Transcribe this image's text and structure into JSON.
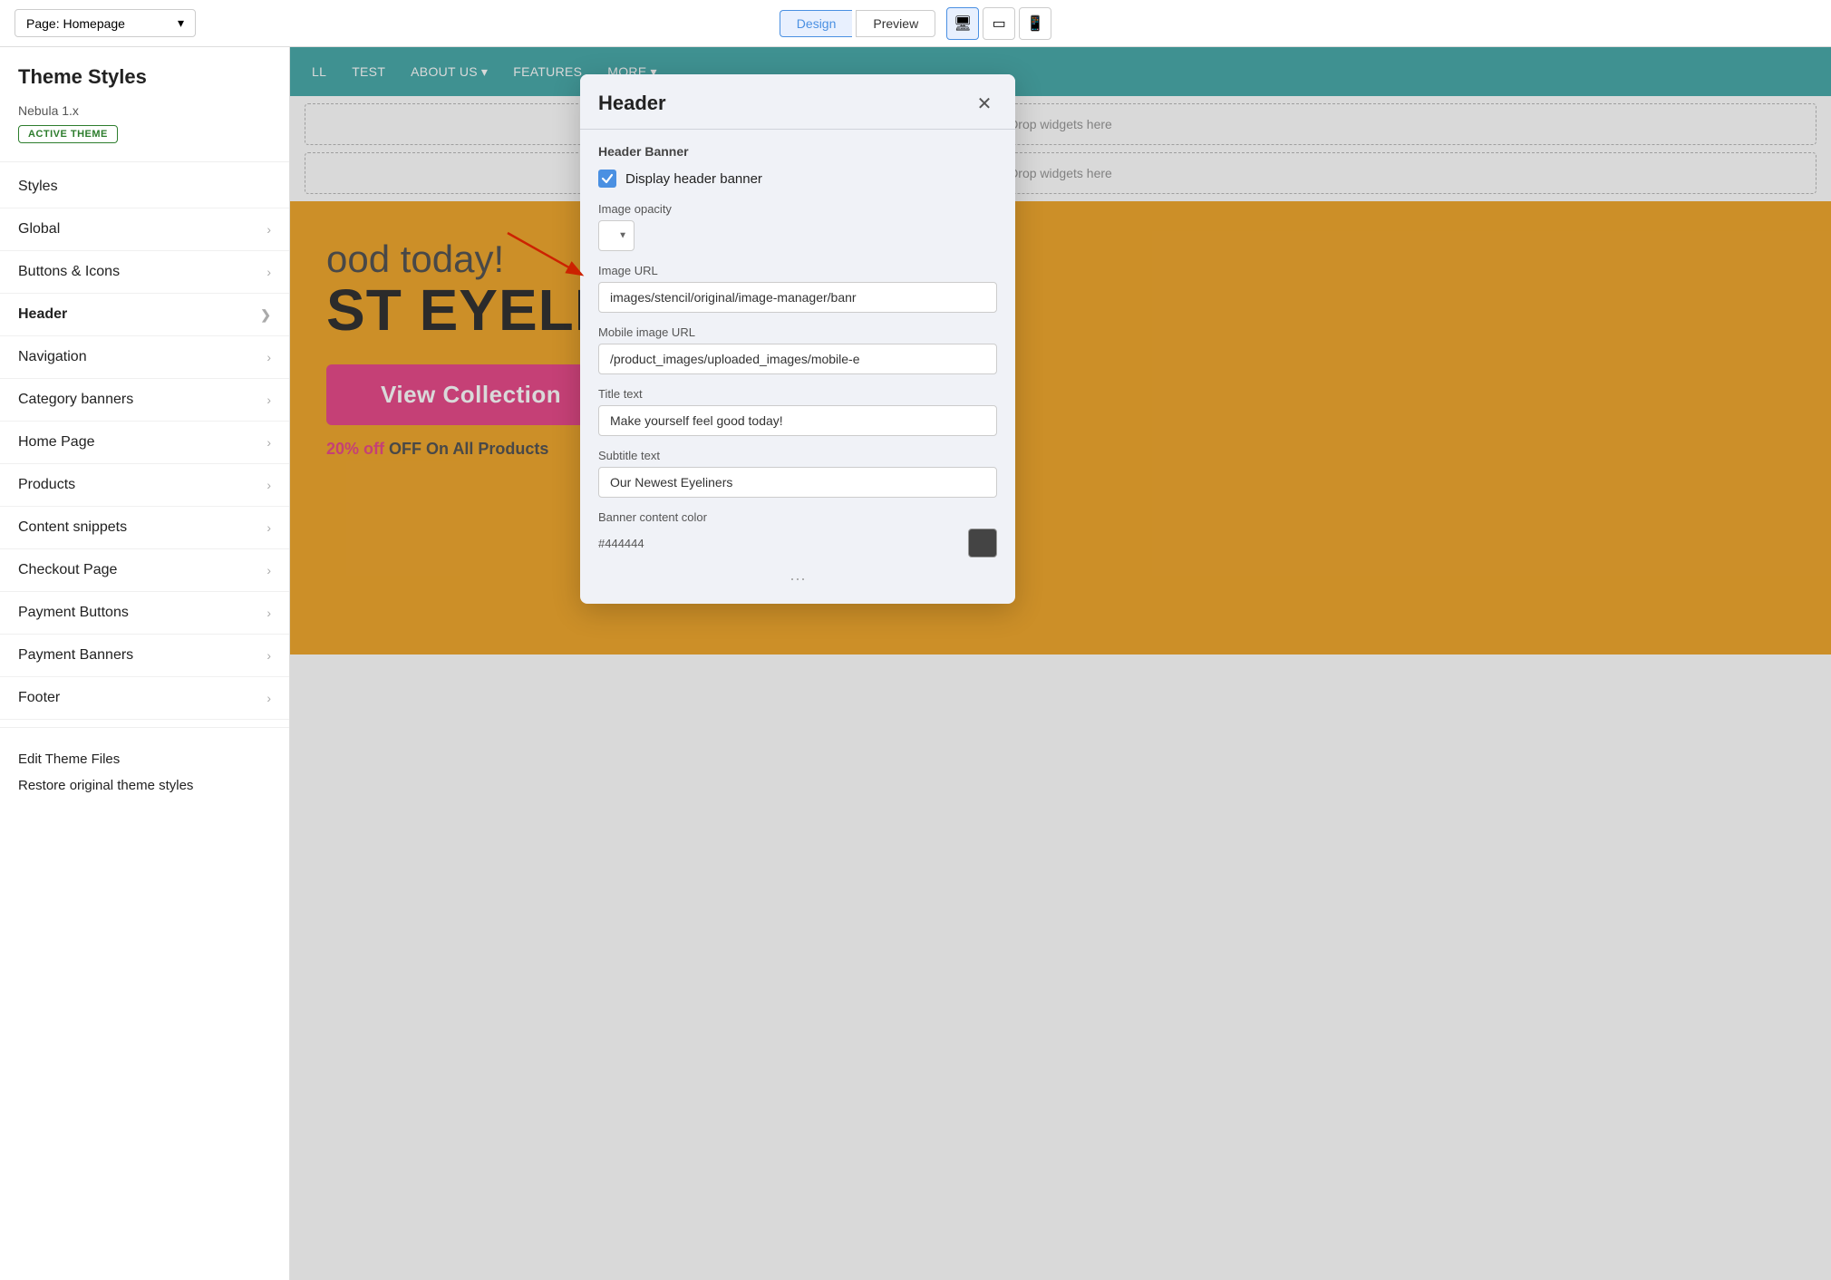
{
  "topbar": {
    "page_selector": "Page: Homepage",
    "btn_design": "Design",
    "btn_preview": "Preview",
    "devices": [
      "desktop",
      "tablet",
      "mobile"
    ]
  },
  "sidebar": {
    "title": "Theme Styles",
    "theme_name": "Nebula 1.x",
    "active_badge": "ACTIVE THEME",
    "items": [
      {
        "label": "Styles",
        "has_chevron": false
      },
      {
        "label": "Global",
        "has_chevron": true
      },
      {
        "label": "Buttons & Icons",
        "has_chevron": true
      },
      {
        "label": "Header",
        "has_chevron": true,
        "active": true
      },
      {
        "label": "Navigation",
        "has_chevron": true
      },
      {
        "label": "Category banners",
        "has_chevron": true
      },
      {
        "label": "Home Page",
        "has_chevron": true
      },
      {
        "label": "Products",
        "has_chevron": true
      },
      {
        "label": "Content snippets",
        "has_chevron": true
      },
      {
        "label": "Checkout Page",
        "has_chevron": true
      },
      {
        "label": "Payment Buttons",
        "has_chevron": true
      },
      {
        "label": "Payment Banners",
        "has_chevron": true
      },
      {
        "label": "Footer",
        "has_chevron": true
      }
    ],
    "footer_links": [
      "Edit Theme Files",
      "Restore original theme styles"
    ]
  },
  "preview": {
    "nav_items": [
      "LL",
      "TEST",
      "ABOUT US",
      "FEATURES",
      "MORE"
    ],
    "about_us_has_chevron": true,
    "more_has_chevron": true,
    "drop_zones": [
      "Drop widgets here",
      "Drop widgets here"
    ],
    "hero": {
      "text_good": "ood today!",
      "title": "ST EYELINERS",
      "btn_label": "View Collection",
      "discount_bold": "20% off",
      "discount_rest": " OFF On All Products"
    }
  },
  "modal": {
    "title": "Header",
    "section_label": "Header Banner",
    "checkbox_label": "Display header banner",
    "checkbox_checked": true,
    "image_opacity_label": "Image opacity",
    "image_url_label": "Image URL",
    "image_url_value": "images/stencil/original/image-manager/banr",
    "mobile_url_label": "Mobile image URL",
    "mobile_url_value": "/product_images/uploaded_images/mobile-e",
    "title_text_label": "Title text",
    "title_text_value": "Make yourself feel good today!",
    "subtitle_text_label": "Subtitle text",
    "subtitle_text_value": "Our Newest Eyeliners",
    "banner_color_label": "Banner content color",
    "banner_color_hex": "#444444",
    "banner_color_swatch": "#444444"
  }
}
